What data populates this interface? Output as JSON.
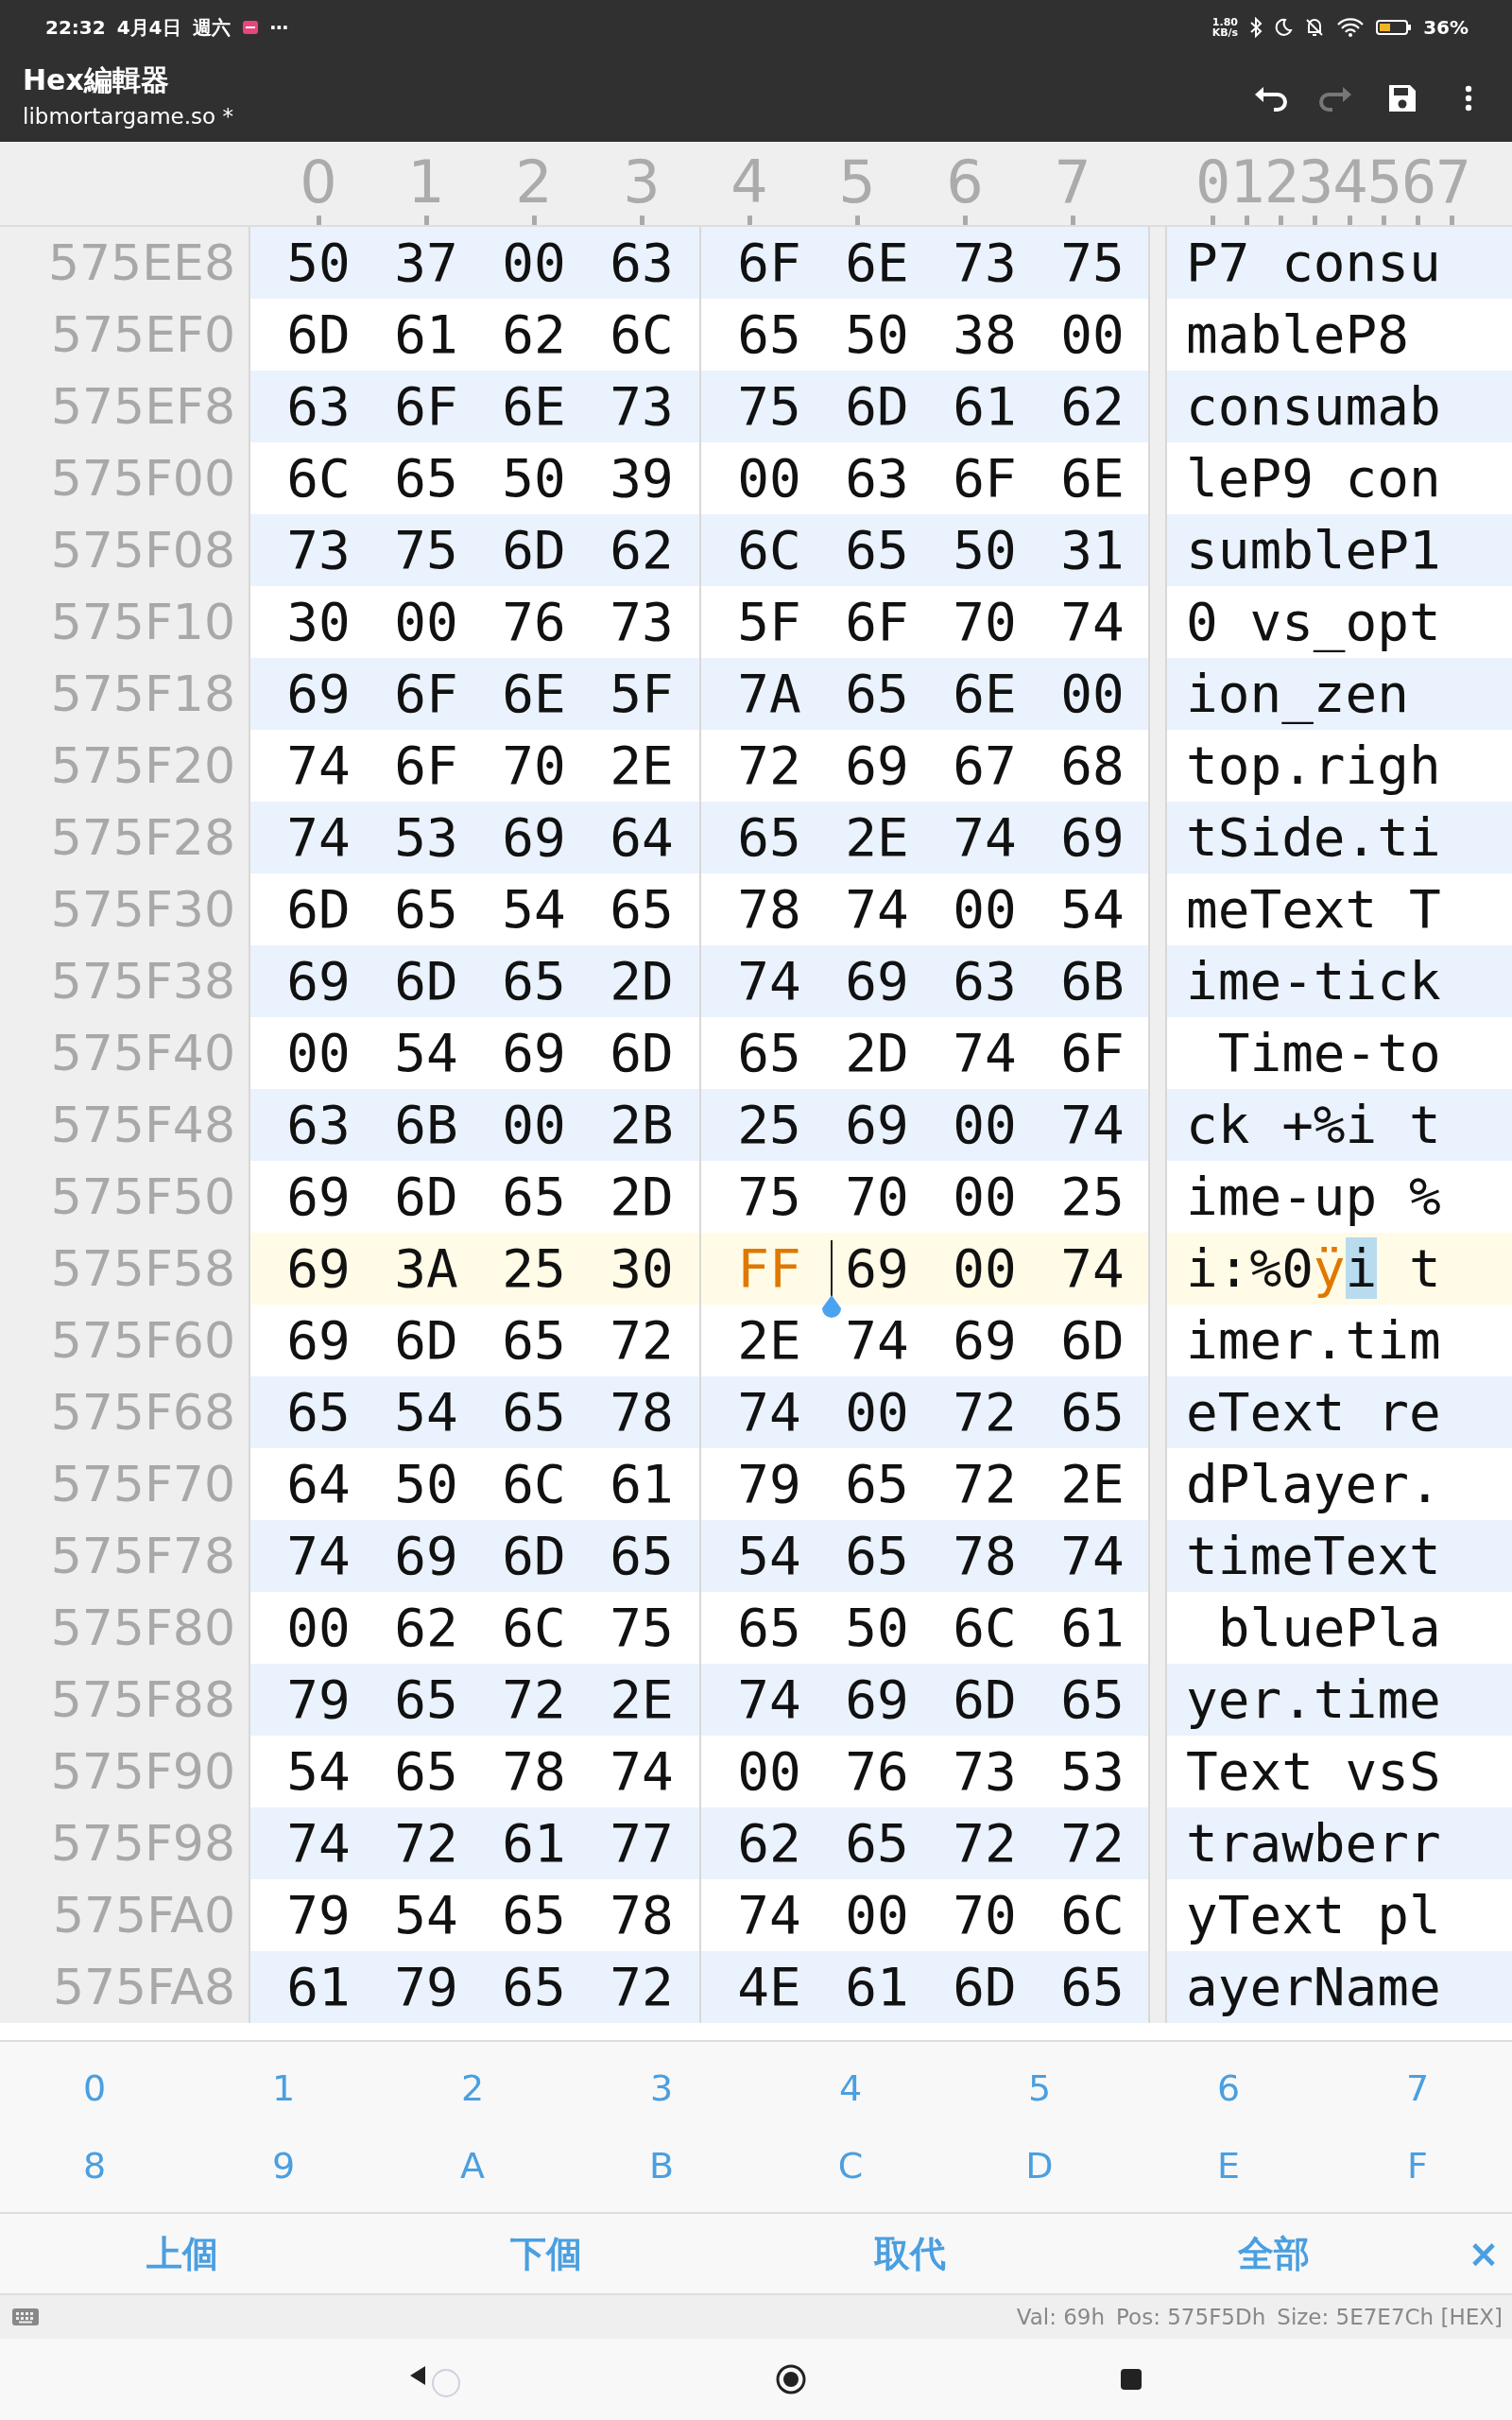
{
  "status_bar": {
    "time": "22:32",
    "date": "4月4日",
    "weekday": "週六",
    "overflow": "⋯",
    "net_speed_value": "1.80",
    "net_speed_unit": "KB/s",
    "battery": "36%"
  },
  "app_bar": {
    "title": "Hex編輯器",
    "subtitle": "libmortargame.so *",
    "actions": [
      {
        "kind": "undo",
        "disabled": false
      },
      {
        "kind": "redo",
        "disabled": true
      },
      {
        "kind": "save",
        "disabled": false
      },
      {
        "kind": "more",
        "disabled": false
      }
    ]
  },
  "header": {
    "byte_columns": [
      "0",
      "1",
      "2",
      "3",
      "4",
      "5",
      "6",
      "7"
    ],
    "ascii_header": "01234567"
  },
  "rows": [
    {
      "offset": "575EE8",
      "bytes": [
        "50",
        "37",
        "00",
        "63",
        "6F",
        "6E",
        "73",
        "75"
      ],
      "ascii": "P7 consu",
      "selected": false
    },
    {
      "offset": "575EF0",
      "bytes": [
        "6D",
        "61",
        "62",
        "6C",
        "65",
        "50",
        "38",
        "00"
      ],
      "ascii": "mableP8",
      "selected": false
    },
    {
      "offset": "575EF8",
      "bytes": [
        "63",
        "6F",
        "6E",
        "73",
        "75",
        "6D",
        "61",
        "62"
      ],
      "ascii": "consumab",
      "selected": false
    },
    {
      "offset": "575F00",
      "bytes": [
        "6C",
        "65",
        "50",
        "39",
        "00",
        "63",
        "6F",
        "6E"
      ],
      "ascii": "leP9 con",
      "selected": false
    },
    {
      "offset": "575F08",
      "bytes": [
        "73",
        "75",
        "6D",
        "62",
        "6C",
        "65",
        "50",
        "31"
      ],
      "ascii": "sumbleP1",
      "selected": false
    },
    {
      "offset": "575F10",
      "bytes": [
        "30",
        "00",
        "76",
        "73",
        "5F",
        "6F",
        "70",
        "74"
      ],
      "ascii": "0 vs_opt",
      "selected": false
    },
    {
      "offset": "575F18",
      "bytes": [
        "69",
        "6F",
        "6E",
        "5F",
        "7A",
        "65",
        "6E",
        "00"
      ],
      "ascii": "ion_zen",
      "selected": false
    },
    {
      "offset": "575F20",
      "bytes": [
        "74",
        "6F",
        "70",
        "2E",
        "72",
        "69",
        "67",
        "68"
      ],
      "ascii": "top.righ",
      "selected": false
    },
    {
      "offset": "575F28",
      "bytes": [
        "74",
        "53",
        "69",
        "64",
        "65",
        "2E",
        "74",
        "69"
      ],
      "ascii": "tSide.ti",
      "selected": false
    },
    {
      "offset": "575F30",
      "bytes": [
        "6D",
        "65",
        "54",
        "65",
        "78",
        "74",
        "00",
        "54"
      ],
      "ascii": "meText T",
      "selected": false
    },
    {
      "offset": "575F38",
      "bytes": [
        "69",
        "6D",
        "65",
        "2D",
        "74",
        "69",
        "63",
        "6B"
      ],
      "ascii": "ime-tick",
      "selected": false
    },
    {
      "offset": "575F40",
      "bytes": [
        "00",
        "54",
        "69",
        "6D",
        "65",
        "2D",
        "74",
        "6F"
      ],
      "ascii": " Time-to",
      "selected": false
    },
    {
      "offset": "575F48",
      "bytes": [
        "63",
        "6B",
        "00",
        "2B",
        "25",
        "69",
        "00",
        "74"
      ],
      "ascii": "ck +%i t",
      "selected": false
    },
    {
      "offset": "575F50",
      "bytes": [
        "69",
        "6D",
        "65",
        "2D",
        "75",
        "70",
        "00",
        "25"
      ],
      "ascii": "ime-up %",
      "selected": false
    },
    {
      "offset": "575F58",
      "bytes": [
        "69",
        "3A",
        "25",
        "30",
        "FF",
        "69",
        "00",
        "74"
      ],
      "byte_states": [
        {
          "modified": false,
          "cursor": false
        },
        {
          "modified": false,
          "cursor": false
        },
        {
          "modified": false,
          "cursor": false
        },
        {
          "modified": false,
          "cursor": false
        },
        {
          "modified": true,
          "cursor": false
        },
        {
          "modified": false,
          "cursor": true
        },
        {
          "modified": false,
          "cursor": false
        },
        {
          "modified": false,
          "cursor": false
        }
      ],
      "ascii_parts": [
        {
          "text": "i:%0",
          "kind": "plain"
        },
        {
          "text": "ÿ",
          "kind": "modified"
        },
        {
          "text": "i",
          "kind": "cursor"
        },
        {
          "text": " t",
          "kind": "plain"
        }
      ],
      "selected": true
    },
    {
      "offset": "575F60",
      "bytes": [
        "69",
        "6D",
        "65",
        "72",
        "2E",
        "74",
        "69",
        "6D"
      ],
      "ascii": "imer.tim",
      "selected": false
    },
    {
      "offset": "575F68",
      "bytes": [
        "65",
        "54",
        "65",
        "78",
        "74",
        "00",
        "72",
        "65"
      ],
      "ascii": "eText re",
      "selected": false
    },
    {
      "offset": "575F70",
      "bytes": [
        "64",
        "50",
        "6C",
        "61",
        "79",
        "65",
        "72",
        "2E"
      ],
      "ascii": "dPlayer.",
      "selected": false
    },
    {
      "offset": "575F78",
      "bytes": [
        "74",
        "69",
        "6D",
        "65",
        "54",
        "65",
        "78",
        "74"
      ],
      "ascii": "timeText",
      "selected": false
    },
    {
      "offset": "575F80",
      "bytes": [
        "00",
        "62",
        "6C",
        "75",
        "65",
        "50",
        "6C",
        "61"
      ],
      "ascii": " bluePla",
      "selected": false
    },
    {
      "offset": "575F88",
      "bytes": [
        "79",
        "65",
        "72",
        "2E",
        "74",
        "69",
        "6D",
        "65"
      ],
      "ascii": "yer.time",
      "selected": false
    },
    {
      "offset": "575F90",
      "bytes": [
        "54",
        "65",
        "78",
        "74",
        "00",
        "76",
        "73",
        "53"
      ],
      "ascii": "Text vsS",
      "selected": false
    },
    {
      "offset": "575F98",
      "bytes": [
        "74",
        "72",
        "61",
        "77",
        "62",
        "65",
        "72",
        "72"
      ],
      "ascii": "trawberr",
      "selected": false
    },
    {
      "offset": "575FA0",
      "bytes": [
        "79",
        "54",
        "65",
        "78",
        "74",
        "00",
        "70",
        "6C"
      ],
      "ascii": "yText pl",
      "selected": false
    },
    {
      "offset": "575FA8",
      "bytes": [
        "61",
        "79",
        "65",
        "72",
        "4E",
        "61",
        "6D",
        "65"
      ],
      "ascii": "ayerName",
      "selected": false
    }
  ],
  "keypad": {
    "keys": [
      "0",
      "1",
      "2",
      "3",
      "4",
      "5",
      "6",
      "7",
      "8",
      "9",
      "A",
      "B",
      "C",
      "D",
      "E",
      "F"
    ]
  },
  "search_actions": {
    "buttons": [
      "上個",
      "下個",
      "取代",
      "全部"
    ],
    "close": "×"
  },
  "info_bar": [
    "Val: 69h",
    "Pos: 575F5Dh",
    "Size: 5E7E7Ch [HEX]"
  ]
}
